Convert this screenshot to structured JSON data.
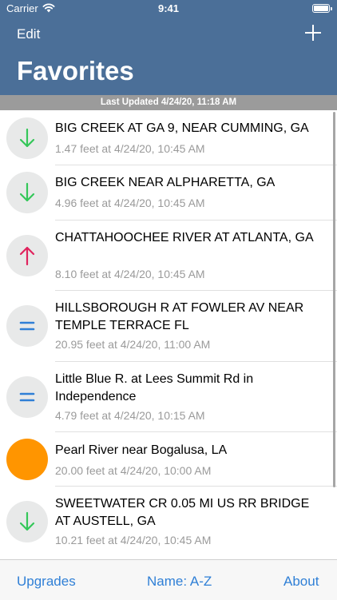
{
  "status_bar": {
    "carrier": "Carrier",
    "time": "9:41"
  },
  "nav": {
    "edit_label": "Edit",
    "title": "Favorites"
  },
  "last_updated": "Last Updated 4/24/20, 11:18 AM",
  "favorites": [
    {
      "name": "BIG CREEK AT GA 9, NEAR CUMMING, GA",
      "reading": "1.47 feet at 4/24/20, 10:45 AM",
      "trend": "down-arrow-icon",
      "color": "#34c759"
    },
    {
      "name": "BIG CREEK NEAR ALPHARETTA, GA",
      "reading": "4.96 feet at 4/24/20, 10:45 AM",
      "trend": "down-arrow-icon",
      "color": "#34c759"
    },
    {
      "name": "CHATTAHOOCHEE RIVER AT ATLANTA, GA",
      "reading": "8.10 feet at 4/24/20, 10:45 AM",
      "trend": "up-arrow-icon",
      "color": "#e0245e"
    },
    {
      "name": "HILLSBOROUGH R AT FOWLER AV NEAR TEMPLE TERRACE FL",
      "reading": "20.95 feet at 4/24/20, 11:00 AM",
      "trend": "equals-icon",
      "color": "#2f7fd6"
    },
    {
      "name": "Little Blue R. at Lees Summit Rd in Independence",
      "reading": "4.79 feet at 4/24/20, 10:15 AM",
      "trend": "equals-icon",
      "color": "#2f7fd6"
    },
    {
      "name": "Pearl River near Bogalusa, LA",
      "reading": "20.00 feet at 4/24/20, 10:00 AM",
      "trend": "orange-status-icon",
      "color": "#ff9500"
    },
    {
      "name": "SWEETWATER CR 0.05 MI US RR BRIDGE AT AUSTELL, GA",
      "reading": "10.21 feet at 4/24/20, 10:45 AM",
      "trend": "down-arrow-icon",
      "color": "#34c759"
    }
  ],
  "tabbar": {
    "upgrades": "Upgrades",
    "sort": "Name: A-Z",
    "about": "About"
  }
}
